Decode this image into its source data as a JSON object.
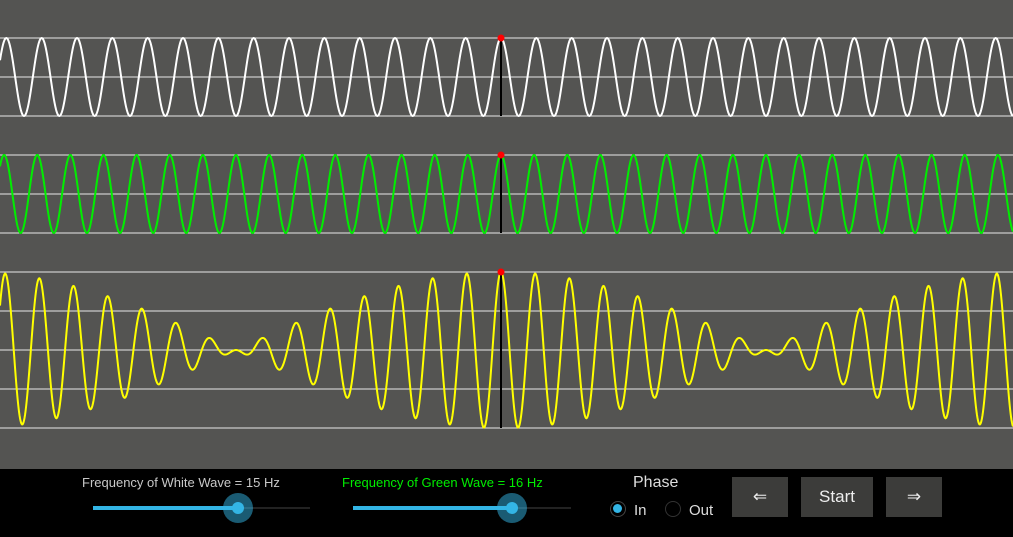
{
  "waves": {
    "white": {
      "frequency_hz": 15,
      "color": "#ffffff"
    },
    "green": {
      "frequency_hz": 16,
      "color": "#00ee00"
    },
    "sum": {
      "color": "#ffff00"
    },
    "marker_color": "#ff0000",
    "background": "#545452"
  },
  "controls": {
    "white_label": "Frequency of White Wave = 15 Hz",
    "green_label": "Frequency of Green Wave = 16 Hz",
    "white_slider_fraction": 0.67,
    "green_slider_fraction": 0.73,
    "phase_label": "Phase",
    "phase_in": "In",
    "phase_out": "Out",
    "phase_selected": "In",
    "back_button": "⇐",
    "start_button": "Start",
    "forward_button": "⇒"
  }
}
